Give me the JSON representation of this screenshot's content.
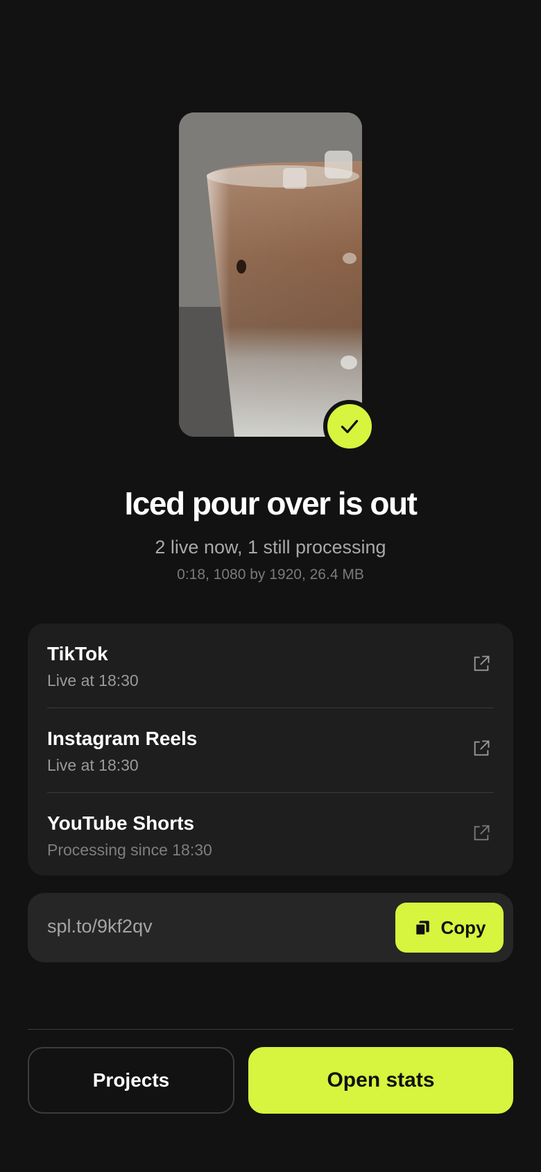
{
  "thumbnail": {
    "alt_icon": "video-thumbnail",
    "badge_icon": "check-icon"
  },
  "header": {
    "title": "Iced pour over is out",
    "subtitle": "2 live now, 1 still processing",
    "meta": "0:18, 1080 by 1920, 26.4 MB"
  },
  "platforms": [
    {
      "name": "TikTok",
      "status": "Live at 18:30",
      "icon": "external-link-icon"
    },
    {
      "name": "Instagram Reels",
      "status": "Live at 18:30",
      "icon": "external-link-icon"
    },
    {
      "name": "YouTube Shorts",
      "status": "Processing since 18:30",
      "icon": "external-link-icon"
    }
  ],
  "share": {
    "link": "spl.to/9kf2qv",
    "copy_label": "Copy",
    "copy_icon": "copy-icon"
  },
  "actions": {
    "projects_label": "Projects",
    "stats_label": "Open stats"
  },
  "colors": {
    "background": "#121212",
    "accent": "#d7f43e",
    "card": "#1e1e1e"
  }
}
